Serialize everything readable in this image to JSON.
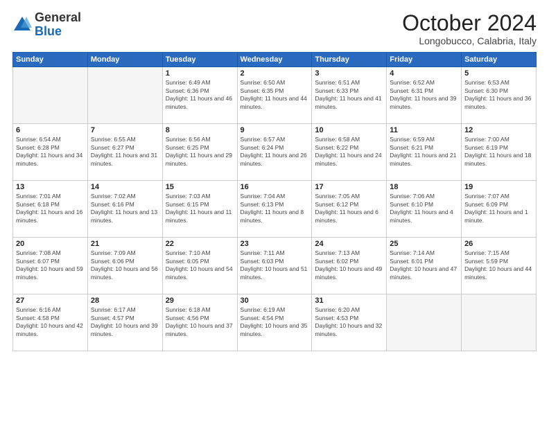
{
  "logo": {
    "general": "General",
    "blue": "Blue"
  },
  "title": "October 2024",
  "location": "Longobucco, Calabria, Italy",
  "days_header": [
    "Sunday",
    "Monday",
    "Tuesday",
    "Wednesday",
    "Thursday",
    "Friday",
    "Saturday"
  ],
  "weeks": [
    [
      {
        "day": "",
        "info": ""
      },
      {
        "day": "",
        "info": ""
      },
      {
        "day": "1",
        "info": "Sunrise: 6:49 AM\nSunset: 6:36 PM\nDaylight: 11 hours and 46 minutes."
      },
      {
        "day": "2",
        "info": "Sunrise: 6:50 AM\nSunset: 6:35 PM\nDaylight: 11 hours and 44 minutes."
      },
      {
        "day": "3",
        "info": "Sunrise: 6:51 AM\nSunset: 6:33 PM\nDaylight: 11 hours and 41 minutes."
      },
      {
        "day": "4",
        "info": "Sunrise: 6:52 AM\nSunset: 6:31 PM\nDaylight: 11 hours and 39 minutes."
      },
      {
        "day": "5",
        "info": "Sunrise: 6:53 AM\nSunset: 6:30 PM\nDaylight: 11 hours and 36 minutes."
      }
    ],
    [
      {
        "day": "6",
        "info": "Sunrise: 6:54 AM\nSunset: 6:28 PM\nDaylight: 11 hours and 34 minutes."
      },
      {
        "day": "7",
        "info": "Sunrise: 6:55 AM\nSunset: 6:27 PM\nDaylight: 11 hours and 31 minutes."
      },
      {
        "day": "8",
        "info": "Sunrise: 6:56 AM\nSunset: 6:25 PM\nDaylight: 11 hours and 29 minutes."
      },
      {
        "day": "9",
        "info": "Sunrise: 6:57 AM\nSunset: 6:24 PM\nDaylight: 11 hours and 26 minutes."
      },
      {
        "day": "10",
        "info": "Sunrise: 6:58 AM\nSunset: 6:22 PM\nDaylight: 11 hours and 24 minutes."
      },
      {
        "day": "11",
        "info": "Sunrise: 6:59 AM\nSunset: 6:21 PM\nDaylight: 11 hours and 21 minutes."
      },
      {
        "day": "12",
        "info": "Sunrise: 7:00 AM\nSunset: 6:19 PM\nDaylight: 11 hours and 18 minutes."
      }
    ],
    [
      {
        "day": "13",
        "info": "Sunrise: 7:01 AM\nSunset: 6:18 PM\nDaylight: 11 hours and 16 minutes."
      },
      {
        "day": "14",
        "info": "Sunrise: 7:02 AM\nSunset: 6:16 PM\nDaylight: 11 hours and 13 minutes."
      },
      {
        "day": "15",
        "info": "Sunrise: 7:03 AM\nSunset: 6:15 PM\nDaylight: 11 hours and 11 minutes."
      },
      {
        "day": "16",
        "info": "Sunrise: 7:04 AM\nSunset: 6:13 PM\nDaylight: 11 hours and 8 minutes."
      },
      {
        "day": "17",
        "info": "Sunrise: 7:05 AM\nSunset: 6:12 PM\nDaylight: 11 hours and 6 minutes."
      },
      {
        "day": "18",
        "info": "Sunrise: 7:06 AM\nSunset: 6:10 PM\nDaylight: 11 hours and 4 minutes."
      },
      {
        "day": "19",
        "info": "Sunrise: 7:07 AM\nSunset: 6:09 PM\nDaylight: 11 hours and 1 minute."
      }
    ],
    [
      {
        "day": "20",
        "info": "Sunrise: 7:08 AM\nSunset: 6:07 PM\nDaylight: 10 hours and 59 minutes."
      },
      {
        "day": "21",
        "info": "Sunrise: 7:09 AM\nSunset: 6:06 PM\nDaylight: 10 hours and 56 minutes."
      },
      {
        "day": "22",
        "info": "Sunrise: 7:10 AM\nSunset: 6:05 PM\nDaylight: 10 hours and 54 minutes."
      },
      {
        "day": "23",
        "info": "Sunrise: 7:11 AM\nSunset: 6:03 PM\nDaylight: 10 hours and 51 minutes."
      },
      {
        "day": "24",
        "info": "Sunrise: 7:13 AM\nSunset: 6:02 PM\nDaylight: 10 hours and 49 minutes."
      },
      {
        "day": "25",
        "info": "Sunrise: 7:14 AM\nSunset: 6:01 PM\nDaylight: 10 hours and 47 minutes."
      },
      {
        "day": "26",
        "info": "Sunrise: 7:15 AM\nSunset: 5:59 PM\nDaylight: 10 hours and 44 minutes."
      }
    ],
    [
      {
        "day": "27",
        "info": "Sunrise: 6:16 AM\nSunset: 4:58 PM\nDaylight: 10 hours and 42 minutes."
      },
      {
        "day": "28",
        "info": "Sunrise: 6:17 AM\nSunset: 4:57 PM\nDaylight: 10 hours and 39 minutes."
      },
      {
        "day": "29",
        "info": "Sunrise: 6:18 AM\nSunset: 4:56 PM\nDaylight: 10 hours and 37 minutes."
      },
      {
        "day": "30",
        "info": "Sunrise: 6:19 AM\nSunset: 4:54 PM\nDaylight: 10 hours and 35 minutes."
      },
      {
        "day": "31",
        "info": "Sunrise: 6:20 AM\nSunset: 4:53 PM\nDaylight: 10 hours and 32 minutes."
      },
      {
        "day": "",
        "info": ""
      },
      {
        "day": "",
        "info": ""
      }
    ]
  ]
}
